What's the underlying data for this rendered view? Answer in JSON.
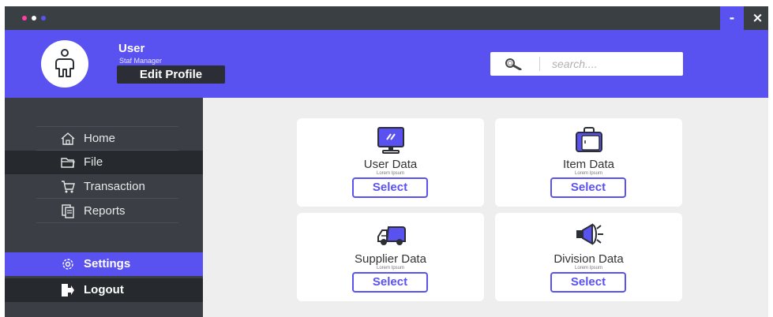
{
  "colors": {
    "accent": "#5a52f0",
    "titlebar": "#3a3f44",
    "sidebar": "#3b3f45",
    "sidebar_active": "#26292d",
    "content_bg": "#eeeeee",
    "dot_pink": "#ff3fa4",
    "dot_white": "#ffffff",
    "dot_blue": "#5a52f0"
  },
  "titlebar": {
    "minimize_label": "-",
    "close_label": "×"
  },
  "header": {
    "user_name": "User",
    "user_role": "Staf Manager",
    "edit_profile_label": "Edit Profile",
    "search_placeholder": "search...."
  },
  "sidebar": {
    "items": [
      {
        "label": "Home",
        "icon": "home-icon"
      },
      {
        "label": "File",
        "icon": "folder-icon"
      },
      {
        "label": "Transaction",
        "icon": "cart-icon"
      },
      {
        "label": "Reports",
        "icon": "reports-icon"
      }
    ],
    "settings_label": "Settings",
    "logout_label": "Logout"
  },
  "cards": [
    {
      "title": "User Data",
      "subtitle": "Lorem Ipsum",
      "button_label": "Select",
      "icon": "monitor-icon"
    },
    {
      "title": "Item Data",
      "subtitle": "Lorem Ipsum",
      "button_label": "Select",
      "icon": "briefcase-icon"
    },
    {
      "title": "Supplier Data",
      "subtitle": "Lorem Ipsum",
      "button_label": "Select",
      "icon": "truck-icon"
    },
    {
      "title": "Division Data",
      "subtitle": "Lorem Ipsum",
      "button_label": "Select",
      "icon": "megaphone-icon"
    }
  ]
}
